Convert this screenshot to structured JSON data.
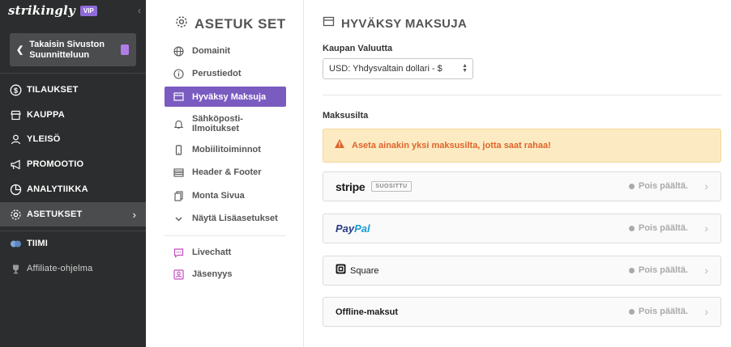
{
  "sidebar": {
    "brand": "strikingly",
    "vip_badge": "VIP",
    "collapse_glyph": "‹",
    "back_button": "Takaisin Sivuston Suunnitteluun",
    "items": [
      {
        "label": "TILAUKSET",
        "icon": "dollar-icon"
      },
      {
        "label": "KAUPPA",
        "icon": "store-icon"
      },
      {
        "label": "YLEISÖ",
        "icon": "audience-icon"
      },
      {
        "label": "PROMOOTIO",
        "icon": "megaphone-icon"
      },
      {
        "label": "ANALYTIIKKA",
        "icon": "pie-chart-icon"
      },
      {
        "label": "ASETUKSET",
        "icon": "gear-icon"
      },
      {
        "label": "TIIMI",
        "icon": "team-icon"
      },
      {
        "label": "Affiliate-ohjelma",
        "icon": "trophy-icon"
      }
    ]
  },
  "settings": {
    "title": "ASETUK SET",
    "items": [
      {
        "label": "Domainit"
      },
      {
        "label": "Perustiedot"
      },
      {
        "label": "Hyväksy Maksuja"
      },
      {
        "label": "Sähköposti-Ilmoitukset"
      },
      {
        "label": "Mobiilitoiminnot"
      },
      {
        "label": "Header & Footer"
      },
      {
        "label": "Monta Sivua"
      },
      {
        "label": "Näytä Lisäasetukset"
      },
      {
        "label": "Livechatt"
      },
      {
        "label": "Jäsenyys"
      }
    ]
  },
  "main": {
    "title": "HYVÄKSY MAKSUJA",
    "currency_label": "Kaupan Valuutta",
    "currency_value": "USD: Yhdysvaltain dollari - $",
    "gateways_title": "Maksusilta",
    "warning": "Aseta ainakin yksi maksusilta, jotta saat rahaa!",
    "gateways": [
      {
        "name": "stripe",
        "badge": "SUOSITTU",
        "status": "Pois päältä."
      },
      {
        "name_part1": "Pay",
        "name_part2": "Pal",
        "status": "Pois päältä."
      },
      {
        "name": "Square",
        "status": "Pois päältä."
      },
      {
        "name": "Offline-maksut",
        "status": "Pois päältä."
      }
    ]
  },
  "colors": {
    "sidebar_bg": "#2c2d2e",
    "accent_purple": "#7a5bc0",
    "warning_bg": "#fcebc2",
    "warning_text": "#e0632a"
  }
}
